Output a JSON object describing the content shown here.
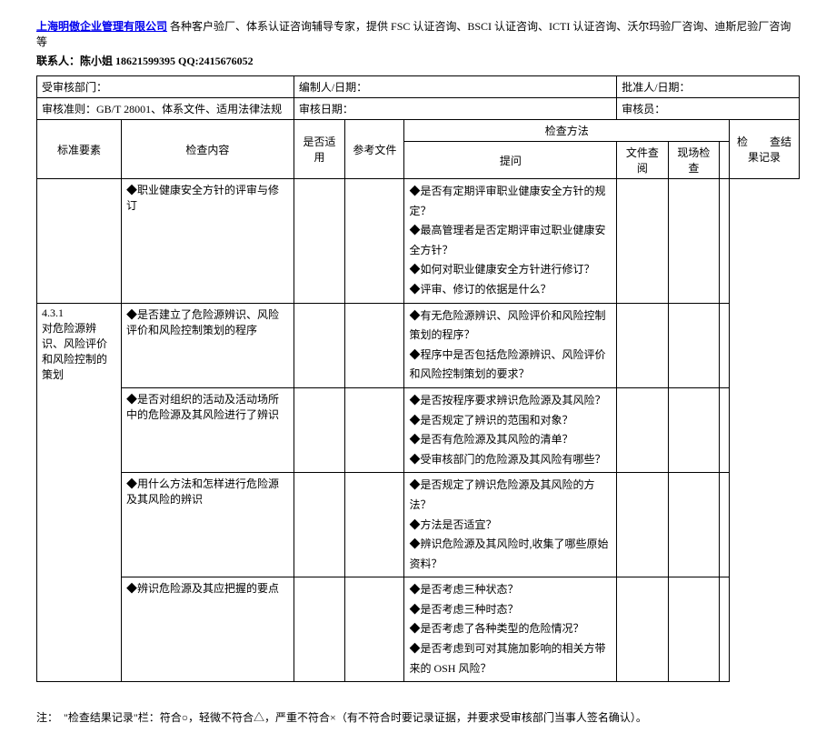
{
  "header": {
    "company_link": "上海明傲企业管理有限公司",
    "company_desc": " 各种客户验厂、体系认证咨询辅导专家，提供 FSC 认证咨询、BSCI 认证咨询、ICTI 认证咨询、沃尔玛验厂咨询、迪斯尼验厂咨询等",
    "contact": "联系人：陈小姐  18621599395 QQ:2415676052"
  },
  "info_row": {
    "dept_label": "受审核部门：",
    "preparer_label": "编制人/日期：",
    "approver_label": "批准人/日期："
  },
  "criteria_row": {
    "criteria_label": "审核准则：",
    "criteria_value": "GB/T 28001、体系文件、适用法律法规",
    "audit_date_label": "审核日期：",
    "auditor_label": "审核员："
  },
  "headers": {
    "element": "标准要素",
    "content": "检查内容",
    "applicable": "是否适用",
    "reference": "参考文件",
    "method": "检查方法",
    "question": "提问",
    "doc_review": "文件查阅",
    "site_check": "现场检查",
    "result": "检　　查结果记录"
  },
  "rows": [
    {
      "element": "",
      "content": "◆职业健康安全方针的评审与修订",
      "questions": [
        "◆是否有定期评审职业健康安全方针的规定？",
        "◆最高管理者是否定期评审过职业健康安全方针？",
        "◆如何对职业健康安全方针进行修订？",
        "◆评审、修订的依据是什么？"
      ]
    },
    {
      "element": "4.3.1\n对危险源辨识、风险评价和风险控制的策划",
      "content": "◆是否建立了危险源辨识、风险评价和风险控制策划的程序",
      "questions": [
        "◆有无危险源辨识、风险评价和风险控制策划的程序？",
        "◆程序中是否包括危险源辨识、风险评价和风险控制策划的要求？"
      ]
    },
    {
      "element": "",
      "content": "◆是否对组织的活动及活动场所中的危险源及其风险进行了辨识",
      "questions": [
        "◆是否按程序要求辨识危险源及其风险？",
        "◆是否规定了辨识的范围和对象？",
        "◆是否有危险源及其风险的清单？",
        "◆受审核部门的危险源及其风险有哪些？"
      ]
    },
    {
      "element": "",
      "content": "◆用什么方法和怎样进行危险源及其风险的辨识",
      "questions": [
        "◆是否规定了辨识危险源及其风险的方法？",
        "◆方法是否适宜？",
        "◆辨识危险源及其风险时,收集了哪些原始资料？"
      ]
    },
    {
      "element": "",
      "content": "◆辨识危险源及其应把握的要点",
      "questions": [
        "◆是否考虑三种状态？",
        "◆是否考虑三种时态？",
        "◆是否考虑了各种类型的危险情况？",
        "◆是否考虑到可对其施加影响的相关方带来的 OSH 风险？"
      ]
    }
  ],
  "footnote": "注：　\"检查结果记录\"栏：符合○，轻微不符合△，严重不符合×（有不符合时要记录证据，并要求受审核部门当事人签名确认）。"
}
